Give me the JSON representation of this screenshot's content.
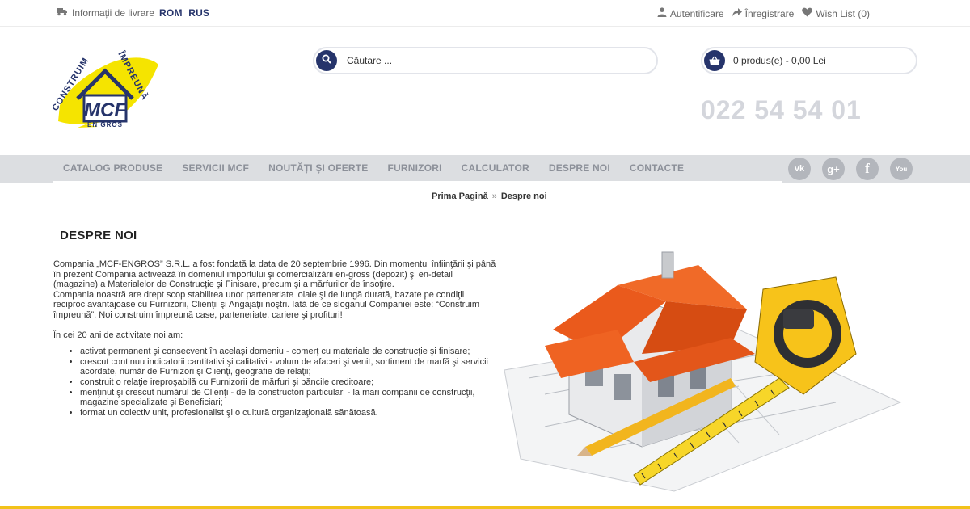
{
  "topbar": {
    "delivery": "Informații de livrare",
    "languages": [
      "ROM",
      "RUS"
    ],
    "login": "Autentificare",
    "register": "Înregistrare",
    "wishlist": "Wish List (0)"
  },
  "logo": {
    "text_top": "CONSTRUIM ÎMPREUNĂ",
    "brand": "MCF",
    "subtitle": "EN GROS"
  },
  "search": {
    "placeholder": "Căutare ..."
  },
  "cart": {
    "label": "0 produs(e) - 0,00 Lei"
  },
  "phone": "022 54 54 01",
  "nav": [
    "CATALOG PRODUSE",
    "SERVICII MCF",
    "NOUTĂȚI ȘI OFERTE",
    "FURNIZORI",
    "CALCULATOR",
    "DESPRE NOI",
    "CONTACTE"
  ],
  "social": [
    {
      "icon": "vk-icon",
      "glyph": "vk"
    },
    {
      "icon": "google-plus-icon",
      "glyph": "g+"
    },
    {
      "icon": "facebook-icon",
      "glyph": "f"
    },
    {
      "icon": "youtube-icon",
      "glyph": "You"
    }
  ],
  "breadcrumb": {
    "home": "Prima Pagină",
    "sep": "»",
    "current": "Despre noi"
  },
  "page": {
    "title": "DESPRE NOI",
    "p1": "Compania „MCF-ENGROS” S.R.L. a fost fondată la data de 20 septembrie 1996. Din momentul  înfiinţării şi până în prezent Compania activează în domeniul importului şi comercializării en-gross (depozit) şi en-detail (magazine) a Materialelor de Construcţie şi Finisare, precum şi a mărfurilor de însoţire.",
    "p2": "Compania noastră are drept scop stabilirea unor parteneriate loiale şi de lungă durată, bazate pe condiţii reciproc avantajoase cu Furnizorii, Clienţii şi Angajaţii noştri. Iată de ce sloganul Companiei este: “Construim împreună”. Noi construim împreună case, parteneriate, cariere şi profituri!",
    "p3": "În cei 20 ani de activitate noi am:",
    "bullets": [
      "activat permanent şi consecvent în acelaşi domeniu - comerţ cu materiale de construcţie şi finisare;",
      "crescut continuu indicatorii cantitativi şi calitativi - volum de afaceri şi venit, sortiment de marfă şi servicii acordate, număr de Furnizori şi Clienţi, geografie de relaţii;",
      "construit o relaţie ireproşabilă cu Furnizorii de mărfuri şi băncile creditoare;",
      "menţinut şi crescut numărul de Clienţi - de la constructori particulari - la mari companii de construcţii, magazine specializate şi Beneficiari;",
      "format un colectiv unit, profesionalist şi o cultură organizaţională sănătoasă."
    ]
  },
  "colors": {
    "brand_blue": "#26346b",
    "accent_yellow": "#f2c21a",
    "nav_bg": "#dcdee1",
    "roof_orange": "#ea5a1c"
  }
}
